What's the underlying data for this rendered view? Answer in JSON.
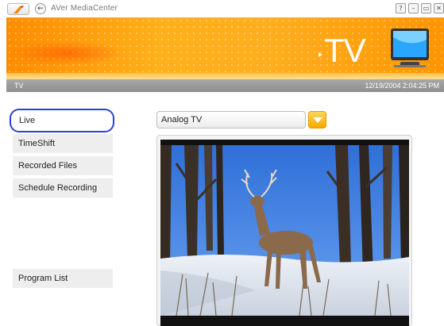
{
  "window": {
    "title": "AVer MediaCenter",
    "controls": [
      "?",
      "–",
      "▭",
      "✕"
    ]
  },
  "banner": {
    "section": "TV",
    "icon": "tv-monitor-icon"
  },
  "status": {
    "section": "TV",
    "datetime": "12/19/2004 2:04:25 PM"
  },
  "sidebar": {
    "items": [
      {
        "label": "Live",
        "selected": true
      },
      {
        "label": "TimeShift"
      },
      {
        "label": "Recorded Files"
      },
      {
        "label": "Schedule Recording"
      },
      {
        "label": "Program List"
      }
    ]
  },
  "source": {
    "selected": "Analog TV"
  },
  "colors": {
    "banner": "#ffa000",
    "selection_outline": "#2f3fd4",
    "dropdown_button": "#f5a800",
    "status_bar": "#999999"
  }
}
